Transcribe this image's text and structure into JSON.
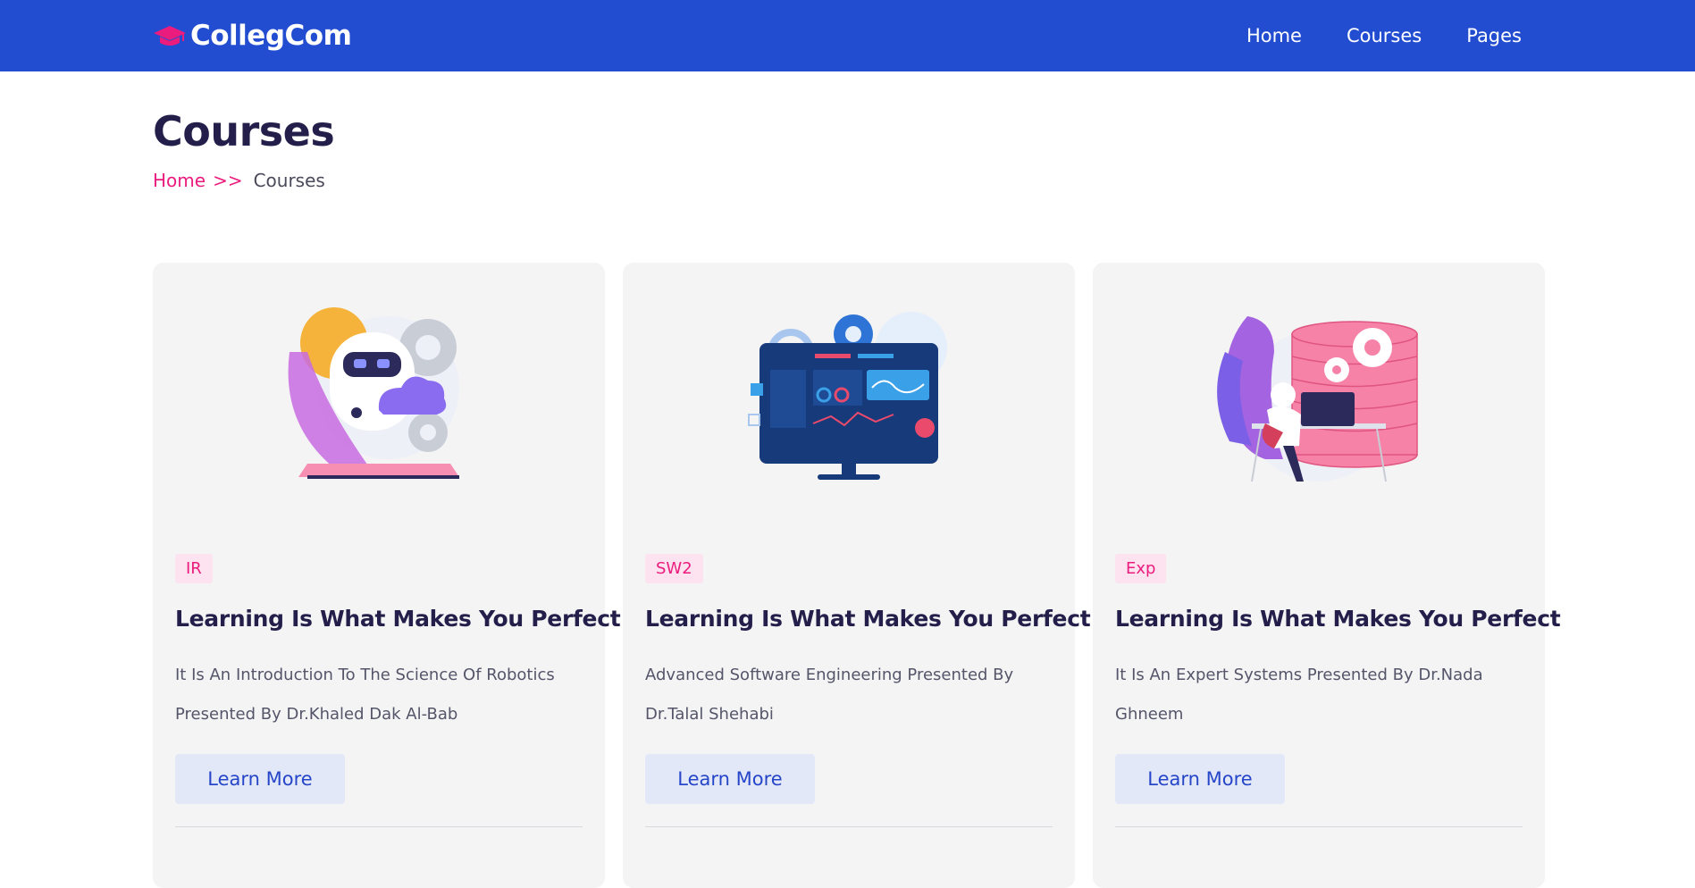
{
  "brand": {
    "name": "CollegCom",
    "icon": "graduation-cap-icon"
  },
  "nav": {
    "items": [
      "Home",
      "Courses",
      "Pages"
    ]
  },
  "page": {
    "title": "Courses",
    "breadcrumb": {
      "home": "Home",
      "separator": ">>",
      "current": "Courses"
    }
  },
  "courses": [
    {
      "tag": "IR",
      "title": "Learning Is What Makes You Perfect",
      "desc_line1": "It Is An Introduction To The Science Of Robotics",
      "desc_line2": "Presented By Dr.Khaled Dak Al-Bab",
      "button": "Learn More",
      "illustration": "robot-illustration"
    },
    {
      "tag": "SW2",
      "title": "Learning Is What Makes You Perfect",
      "desc_line1": "Advanced Software Engineering Presented By",
      "desc_line2": "Dr.Talal Shehabi",
      "button": "Learn More",
      "illustration": "dashboard-monitor-illustration"
    },
    {
      "tag": "Exp",
      "title": "Learning Is What Makes You Perfect",
      "desc_line1": "It Is An Expert Systems Presented By Dr.Nada",
      "desc_line2": "Ghneem",
      "button": "Learn More",
      "illustration": "database-illustration"
    }
  ],
  "colors": {
    "header": "#234dd1",
    "accent": "#ea1c7e",
    "title": "#231f4a",
    "button_bg": "#e3e8f8",
    "button_text": "#2546c8"
  }
}
